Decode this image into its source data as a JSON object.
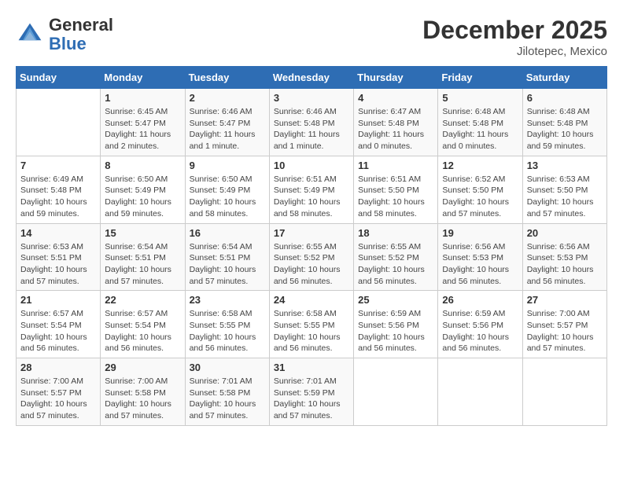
{
  "header": {
    "logo_general": "General",
    "logo_blue": "Blue",
    "month_year": "December 2025",
    "location": "Jilotepec, Mexico"
  },
  "calendar": {
    "weekdays": [
      "Sunday",
      "Monday",
      "Tuesday",
      "Wednesday",
      "Thursday",
      "Friday",
      "Saturday"
    ],
    "weeks": [
      [
        {
          "day": "",
          "info": ""
        },
        {
          "day": "1",
          "info": "Sunrise: 6:45 AM\nSunset: 5:47 PM\nDaylight: 11 hours\nand 2 minutes."
        },
        {
          "day": "2",
          "info": "Sunrise: 6:46 AM\nSunset: 5:47 PM\nDaylight: 11 hours\nand 1 minute."
        },
        {
          "day": "3",
          "info": "Sunrise: 6:46 AM\nSunset: 5:48 PM\nDaylight: 11 hours\nand 1 minute."
        },
        {
          "day": "4",
          "info": "Sunrise: 6:47 AM\nSunset: 5:48 PM\nDaylight: 11 hours\nand 0 minutes."
        },
        {
          "day": "5",
          "info": "Sunrise: 6:48 AM\nSunset: 5:48 PM\nDaylight: 11 hours\nand 0 minutes."
        },
        {
          "day": "6",
          "info": "Sunrise: 6:48 AM\nSunset: 5:48 PM\nDaylight: 10 hours\nand 59 minutes."
        }
      ],
      [
        {
          "day": "7",
          "info": "Sunrise: 6:49 AM\nSunset: 5:48 PM\nDaylight: 10 hours\nand 59 minutes."
        },
        {
          "day": "8",
          "info": "Sunrise: 6:50 AM\nSunset: 5:49 PM\nDaylight: 10 hours\nand 59 minutes."
        },
        {
          "day": "9",
          "info": "Sunrise: 6:50 AM\nSunset: 5:49 PM\nDaylight: 10 hours\nand 58 minutes."
        },
        {
          "day": "10",
          "info": "Sunrise: 6:51 AM\nSunset: 5:49 PM\nDaylight: 10 hours\nand 58 minutes."
        },
        {
          "day": "11",
          "info": "Sunrise: 6:51 AM\nSunset: 5:50 PM\nDaylight: 10 hours\nand 58 minutes."
        },
        {
          "day": "12",
          "info": "Sunrise: 6:52 AM\nSunset: 5:50 PM\nDaylight: 10 hours\nand 57 minutes."
        },
        {
          "day": "13",
          "info": "Sunrise: 6:53 AM\nSunset: 5:50 PM\nDaylight: 10 hours\nand 57 minutes."
        }
      ],
      [
        {
          "day": "14",
          "info": "Sunrise: 6:53 AM\nSunset: 5:51 PM\nDaylight: 10 hours\nand 57 minutes."
        },
        {
          "day": "15",
          "info": "Sunrise: 6:54 AM\nSunset: 5:51 PM\nDaylight: 10 hours\nand 57 minutes."
        },
        {
          "day": "16",
          "info": "Sunrise: 6:54 AM\nSunset: 5:51 PM\nDaylight: 10 hours\nand 57 minutes."
        },
        {
          "day": "17",
          "info": "Sunrise: 6:55 AM\nSunset: 5:52 PM\nDaylight: 10 hours\nand 56 minutes."
        },
        {
          "day": "18",
          "info": "Sunrise: 6:55 AM\nSunset: 5:52 PM\nDaylight: 10 hours\nand 56 minutes."
        },
        {
          "day": "19",
          "info": "Sunrise: 6:56 AM\nSunset: 5:53 PM\nDaylight: 10 hours\nand 56 minutes."
        },
        {
          "day": "20",
          "info": "Sunrise: 6:56 AM\nSunset: 5:53 PM\nDaylight: 10 hours\nand 56 minutes."
        }
      ],
      [
        {
          "day": "21",
          "info": "Sunrise: 6:57 AM\nSunset: 5:54 PM\nDaylight: 10 hours\nand 56 minutes."
        },
        {
          "day": "22",
          "info": "Sunrise: 6:57 AM\nSunset: 5:54 PM\nDaylight: 10 hours\nand 56 minutes."
        },
        {
          "day": "23",
          "info": "Sunrise: 6:58 AM\nSunset: 5:55 PM\nDaylight: 10 hours\nand 56 minutes."
        },
        {
          "day": "24",
          "info": "Sunrise: 6:58 AM\nSunset: 5:55 PM\nDaylight: 10 hours\nand 56 minutes."
        },
        {
          "day": "25",
          "info": "Sunrise: 6:59 AM\nSunset: 5:56 PM\nDaylight: 10 hours\nand 56 minutes."
        },
        {
          "day": "26",
          "info": "Sunrise: 6:59 AM\nSunset: 5:56 PM\nDaylight: 10 hours\nand 56 minutes."
        },
        {
          "day": "27",
          "info": "Sunrise: 7:00 AM\nSunset: 5:57 PM\nDaylight: 10 hours\nand 57 minutes."
        }
      ],
      [
        {
          "day": "28",
          "info": "Sunrise: 7:00 AM\nSunset: 5:57 PM\nDaylight: 10 hours\nand 57 minutes."
        },
        {
          "day": "29",
          "info": "Sunrise: 7:00 AM\nSunset: 5:58 PM\nDaylight: 10 hours\nand 57 minutes."
        },
        {
          "day": "30",
          "info": "Sunrise: 7:01 AM\nSunset: 5:58 PM\nDaylight: 10 hours\nand 57 minutes."
        },
        {
          "day": "31",
          "info": "Sunrise: 7:01 AM\nSunset: 5:59 PM\nDaylight: 10 hours\nand 57 minutes."
        },
        {
          "day": "",
          "info": ""
        },
        {
          "day": "",
          "info": ""
        },
        {
          "day": "",
          "info": ""
        }
      ]
    ]
  }
}
